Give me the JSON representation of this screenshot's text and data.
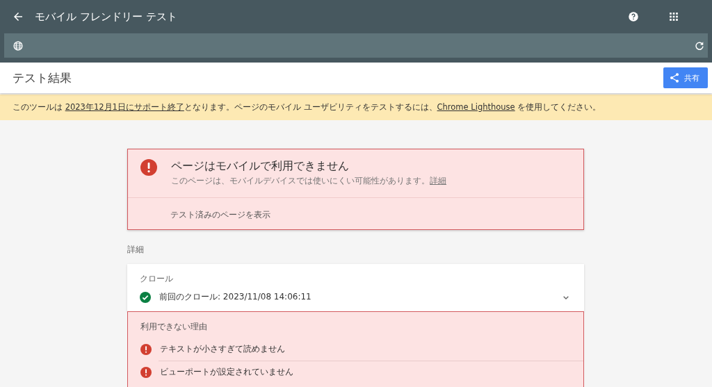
{
  "app_bar": {
    "title": "モバイル フレンドリー テスト"
  },
  "header": {
    "title": "テスト結果",
    "share_button": "共有"
  },
  "notice": {
    "parts": [
      {
        "text": "このツールは ",
        "link": false
      },
      {
        "text": "2023年12月1日にサポート終了",
        "link": true
      },
      {
        "text": "となります。ページのモバイル ユーザビリティをテストするには、",
        "link": false
      },
      {
        "text": "Chrome Lighthouse",
        "link": true
      },
      {
        "text": " を使用してください。",
        "link": false
      }
    ]
  },
  "result": {
    "kind": "error",
    "title": "ページはモバイルで利用できません",
    "description": "このページは、モバイルデバイスでは使いにくい可能性があります。",
    "link": "詳細",
    "action": "テスト済みのページを表示"
  },
  "details": {
    "heading": "詳細",
    "crawl": {
      "label": "クロール",
      "kind": "ok",
      "text": "前回のクロール: 2023/11/08 14:06:11",
      "expanded": false
    },
    "reasons": {
      "label": "利用できない理由",
      "items": [
        {
          "kind": "error",
          "text": "テキストが小さすぎて読めません"
        },
        {
          "kind": "error",
          "text": "ビューポートが設定されていません"
        }
      ]
    }
  }
}
